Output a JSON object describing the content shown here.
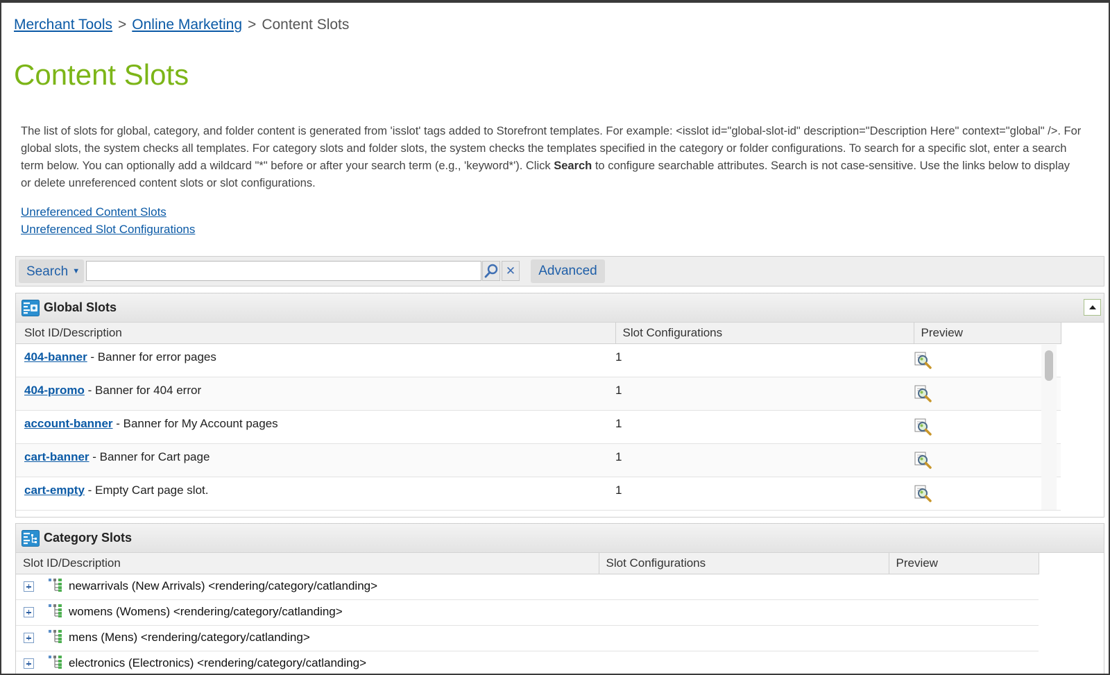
{
  "breadcrumb": {
    "items": [
      "Merchant Tools",
      "Online Marketing"
    ],
    "current": "Content Slots",
    "separator": ">"
  },
  "page_title": "Content Slots",
  "description": {
    "part1": "The list of slots for global, category, and folder content is generated from 'isslot' tags added to Storefront templates. For example: <isslot id=\"global-slot-id\" description=\"Description Here\" context=\"global\" />. For global slots, the system checks all templates. For category slots and folder slots, the system checks the templates specified in the category or folder configurations. To search for a specific slot, enter a search term below. You can optionally add a wildcard \"*\" before or after your search term (e.g., 'keyword*'). Click ",
    "bold": "Search",
    "part2": " to configure searchable attributes. Search is not case-sensitive. Use the links below to display or delete unreferenced content slots or slot configurations."
  },
  "links": {
    "unreferenced_slots": "Unreferenced Content Slots",
    "unreferenced_configs": "Unreferenced Slot Configurations"
  },
  "search": {
    "dropdown_label": "Search",
    "input_value": "",
    "advanced_label": "Advanced"
  },
  "global_slots": {
    "title": "Global Slots",
    "columns": [
      "Slot ID/Description",
      "Slot Configurations",
      "Preview"
    ],
    "rows": [
      {
        "id": "404-banner",
        "desc": " - Banner for error pages",
        "configs": "1"
      },
      {
        "id": "404-promo",
        "desc": " - Banner for 404 error",
        "configs": "1"
      },
      {
        "id": "account-banner",
        "desc": " - Banner for My Account pages",
        "configs": "1"
      },
      {
        "id": "cart-banner",
        "desc": " - Banner for Cart page",
        "configs": "1"
      },
      {
        "id": "cart-empty",
        "desc": " - Empty Cart page slot.",
        "configs": "1"
      }
    ]
  },
  "category_slots": {
    "title": "Category Slots",
    "columns": [
      "Slot ID/Description",
      "Slot Configurations",
      "Preview"
    ],
    "rows": [
      {
        "label": "newarrivals (New Arrivals) <rendering/category/catlanding>"
      },
      {
        "label": "womens (Womens) <rendering/category/catlanding>"
      },
      {
        "label": "mens (Mens) <rendering/category/catlanding>"
      },
      {
        "label": "electronics (Electronics) <rendering/category/catlanding>"
      }
    ]
  },
  "colors": {
    "title_green": "#7cb518",
    "link_blue": "#0b5aa6"
  }
}
